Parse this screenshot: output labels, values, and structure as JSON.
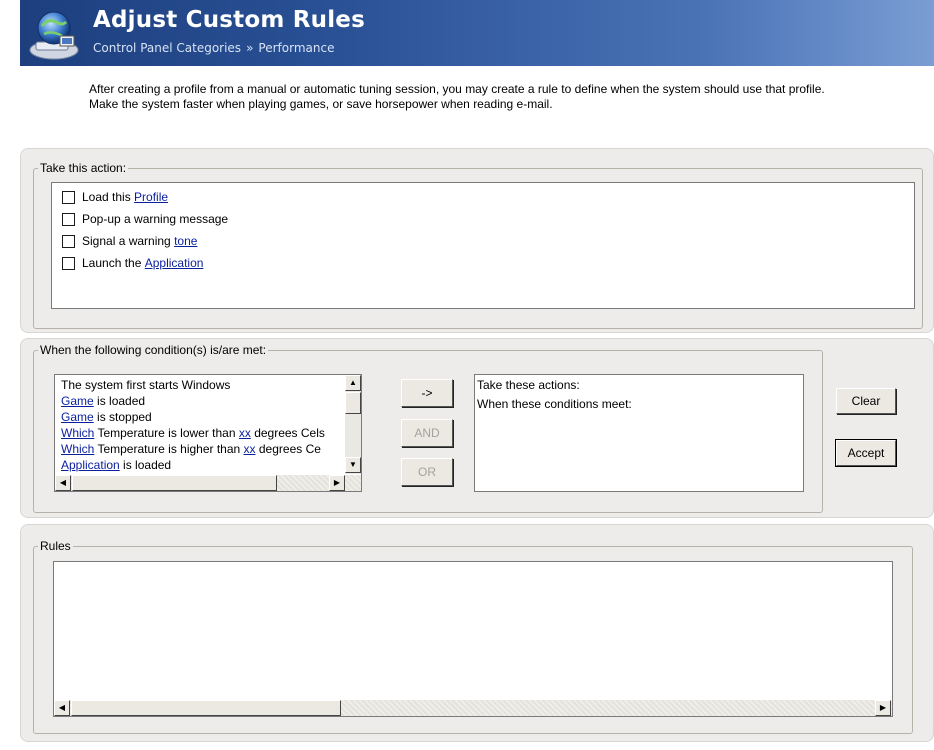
{
  "header": {
    "title": "Adjust Custom Rules",
    "breadcrumb": [
      "Control Panel Categories",
      "»",
      "Performance"
    ]
  },
  "description": {
    "line1": "After creating a profile from a manual or automatic tuning session, you may create a rule to define when the system should use that profile.",
    "line2": "Make the system faster when playing games, or save horsepower when reading e-mail."
  },
  "action_group": {
    "legend": "Take this action:",
    "items": [
      {
        "prefix": "Load this ",
        "link": "Profile",
        "suffix": ""
      },
      {
        "prefix": "Pop-up a warning message",
        "link": "",
        "suffix": ""
      },
      {
        "prefix": "Signal a warning ",
        "link": "tone",
        "suffix": ""
      },
      {
        "prefix": "Launch the ",
        "link": "Application",
        "suffix": ""
      }
    ]
  },
  "condition_group": {
    "legend": "When the following condition(s) is/are met:",
    "conditions": [
      {
        "link": "",
        "text": "The system first starts Windows",
        "link2": "",
        "tail": ""
      },
      {
        "link": "Game",
        "text": " is loaded",
        "link2": "",
        "tail": ""
      },
      {
        "link": "Game",
        "text": " is stopped",
        "link2": "",
        "tail": ""
      },
      {
        "link": "Which",
        "text": " Temperature is lower than ",
        "link2": "xx",
        "tail": " degrees Cels"
      },
      {
        "link": "Which",
        "text": " Temperature is higher than ",
        "link2": "xx",
        "tail": " degrees Ce"
      },
      {
        "link": "Application",
        "text": " is loaded",
        "link2": "",
        "tail": ""
      }
    ],
    "buttons": {
      "arrow": "->",
      "and": "AND",
      "or": "OR"
    },
    "summary": {
      "line1": "Take these actions:",
      "line2": "When these conditions meet:"
    }
  },
  "side_buttons": {
    "clear": "Clear",
    "accept": "Accept"
  },
  "rules_group": {
    "legend": "Rules"
  },
  "scroll_glyphs": {
    "up": "▲",
    "down": "▼",
    "left": "◀",
    "right": "▶"
  }
}
